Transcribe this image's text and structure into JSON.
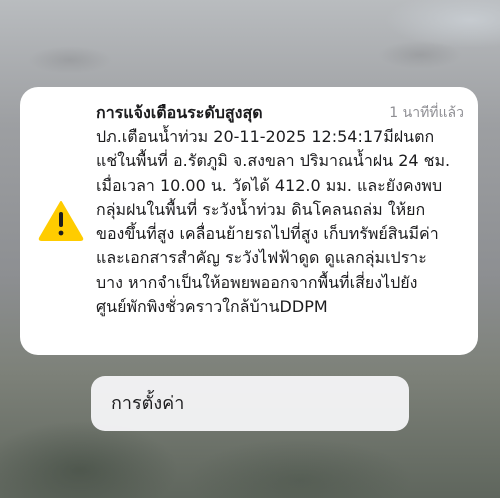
{
  "notification": {
    "icon": "warning-triangle-icon",
    "icon_color": "#ffcc00",
    "title": "การแจ้งเตือนระดับสูงสุด",
    "time": "1 นาทีที่แล้ว",
    "body_lines": [
      "ปภ.เตือนน้ำท่วม  20-11-2025 12:54:17มีฝนตก",
      "แช่ในพื้นที่ อ.รัตภูมิ จ.สงขลา ปริมาณน้ำฝน 24 ชม.",
      "เมื่อเวลา 10.00 น. วัดได้ 412.0 มม. และยังคงพบ",
      "กลุ่มฝนในพื้นที่ ระวังน้ำท่วม ดินโคลนถล่ม ให้ยก",
      "ของขึ้นที่สูง เคลื่อนย้ายรถไปที่สูง เก็บทรัพย์สินมีค่า",
      "และเอกสารสำคัญ ระวังไฟฟ้าดูด ดูแลกลุ่มเปราะ",
      "บาง หากจำเป็นให้อพยพออกจากพื้นที่เสี่ยงไปยัง",
      "ศูนย์พักพิงชั่วคราวใกล้บ้านDDPM"
    ]
  },
  "settings_button": {
    "label": "การตั้งค่า"
  }
}
